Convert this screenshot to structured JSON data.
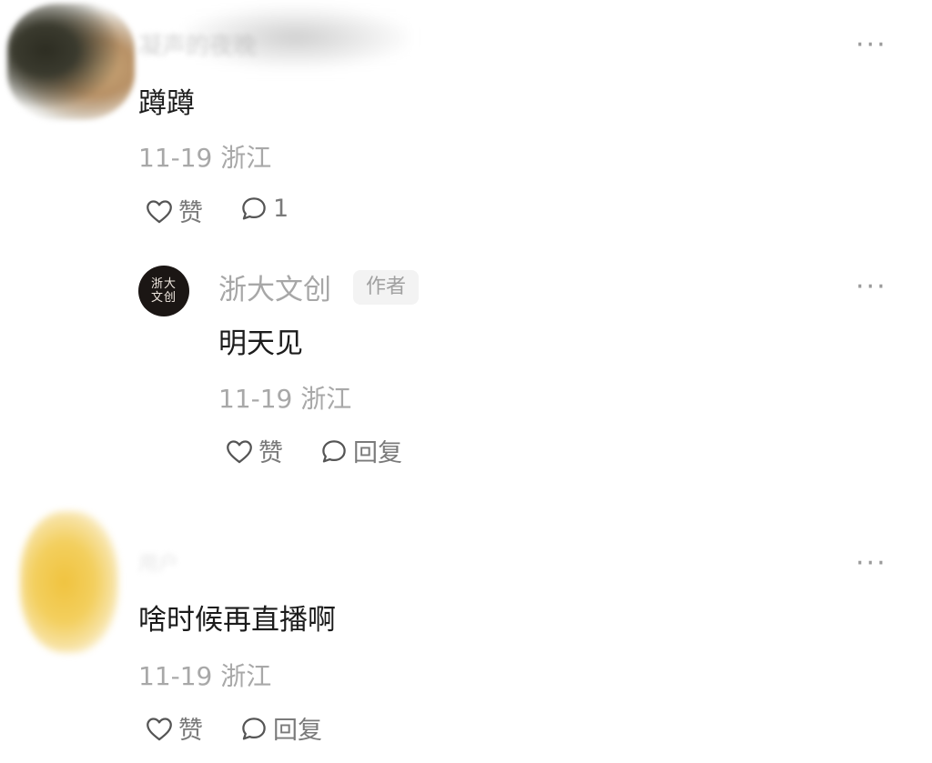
{
  "comments": [
    {
      "author": "凝声的夜晚",
      "text": "蹲蹲",
      "meta": "11-19 浙江",
      "like_label": "赞",
      "reply_label": "1",
      "more_label": "···"
    },
    {
      "author": "浙大文创",
      "badge": "作者",
      "avatar_text": "浙大\n文创",
      "text": "明天见",
      "meta": "11-19 浙江",
      "like_label": "赞",
      "reply_label": "回复",
      "more_label": "···"
    },
    {
      "author": "用户",
      "text": "啥时候再直播啊",
      "meta": "11-19 浙江",
      "like_label": "赞",
      "reply_label": "回复",
      "more_label": "···"
    }
  ],
  "icons": {
    "like": "heart-outline-icon",
    "reply": "chat-bubble-outline-icon",
    "more": "more-horizontal-icon"
  }
}
